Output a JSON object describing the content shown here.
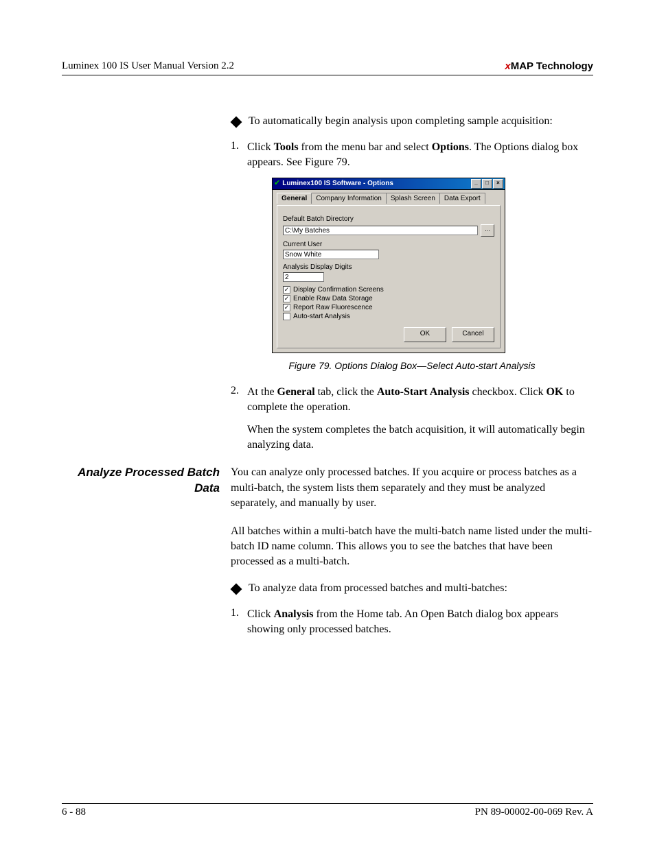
{
  "header": {
    "left": "Luminex 100 IS User Manual Version 2.2",
    "brand_prefix": "x",
    "brand_rest": "MAP Technology"
  },
  "intro_bullet": "To automatically begin analysis upon completing sample acquisition:",
  "step1": {
    "num": "1.",
    "pre": "Click ",
    "b1": "Tools",
    "mid": " from the menu bar and select ",
    "b2": "Options",
    "post": ". The Options dialog box appears. See Figure 79."
  },
  "dialog": {
    "title": "Luminex100 IS Software - Options",
    "tabs": [
      "General",
      "Company Information",
      "Splash Screen",
      "Data Export"
    ],
    "labels": {
      "dir": "Default Batch Directory",
      "user": "Current User",
      "digits": "Analysis Display Digits"
    },
    "values": {
      "dir": "C:\\My Batches",
      "user": "Snow White",
      "digits": "2"
    },
    "checks": [
      {
        "checked": true,
        "label": "Display Confirmation Screens"
      },
      {
        "checked": true,
        "label": "Enable Raw Data Storage"
      },
      {
        "checked": true,
        "label": "Report Raw Fluorescence"
      },
      {
        "checked": false,
        "label": "Auto-start Analysis"
      }
    ],
    "buttons": {
      "ok": "OK",
      "cancel": "Cancel"
    },
    "browse": "..."
  },
  "figure_caption": "Figure 79.  Options Dialog Box—Select Auto-start Analysis",
  "step2": {
    "num": "2.",
    "pre": "At the ",
    "b1": "General",
    "mid1": " tab, click the ",
    "b2": "Auto-Start Analysis",
    "mid2": " checkbox. Click ",
    "b3": "OK",
    "post": " to complete the operation."
  },
  "step2_note": "When the system completes the batch acquisition, it will automatically begin analyzing data.",
  "section_heading": "Analyze Processed Batch Data",
  "section_p1": "You can analyze only processed batches. If you acquire or process batches as a multi-batch, the system lists them separately and they must be analyzed separately, and manually by user.",
  "section_p2": "All batches within a multi-batch have the multi-batch name listed under the multi-batch ID name column. This allows you to see the batches that have been processed as a multi-batch.",
  "section_bullet": "To analyze data from processed batches and multi-batches:",
  "section_step1": {
    "num": "1.",
    "pre": "Click ",
    "b1": "Analysis",
    "post": " from the Home tab. An Open Batch dialog box appears showing only processed batches."
  },
  "footer": {
    "left": "6 - 88",
    "right": "PN 89-00002-00-069 Rev. A"
  }
}
